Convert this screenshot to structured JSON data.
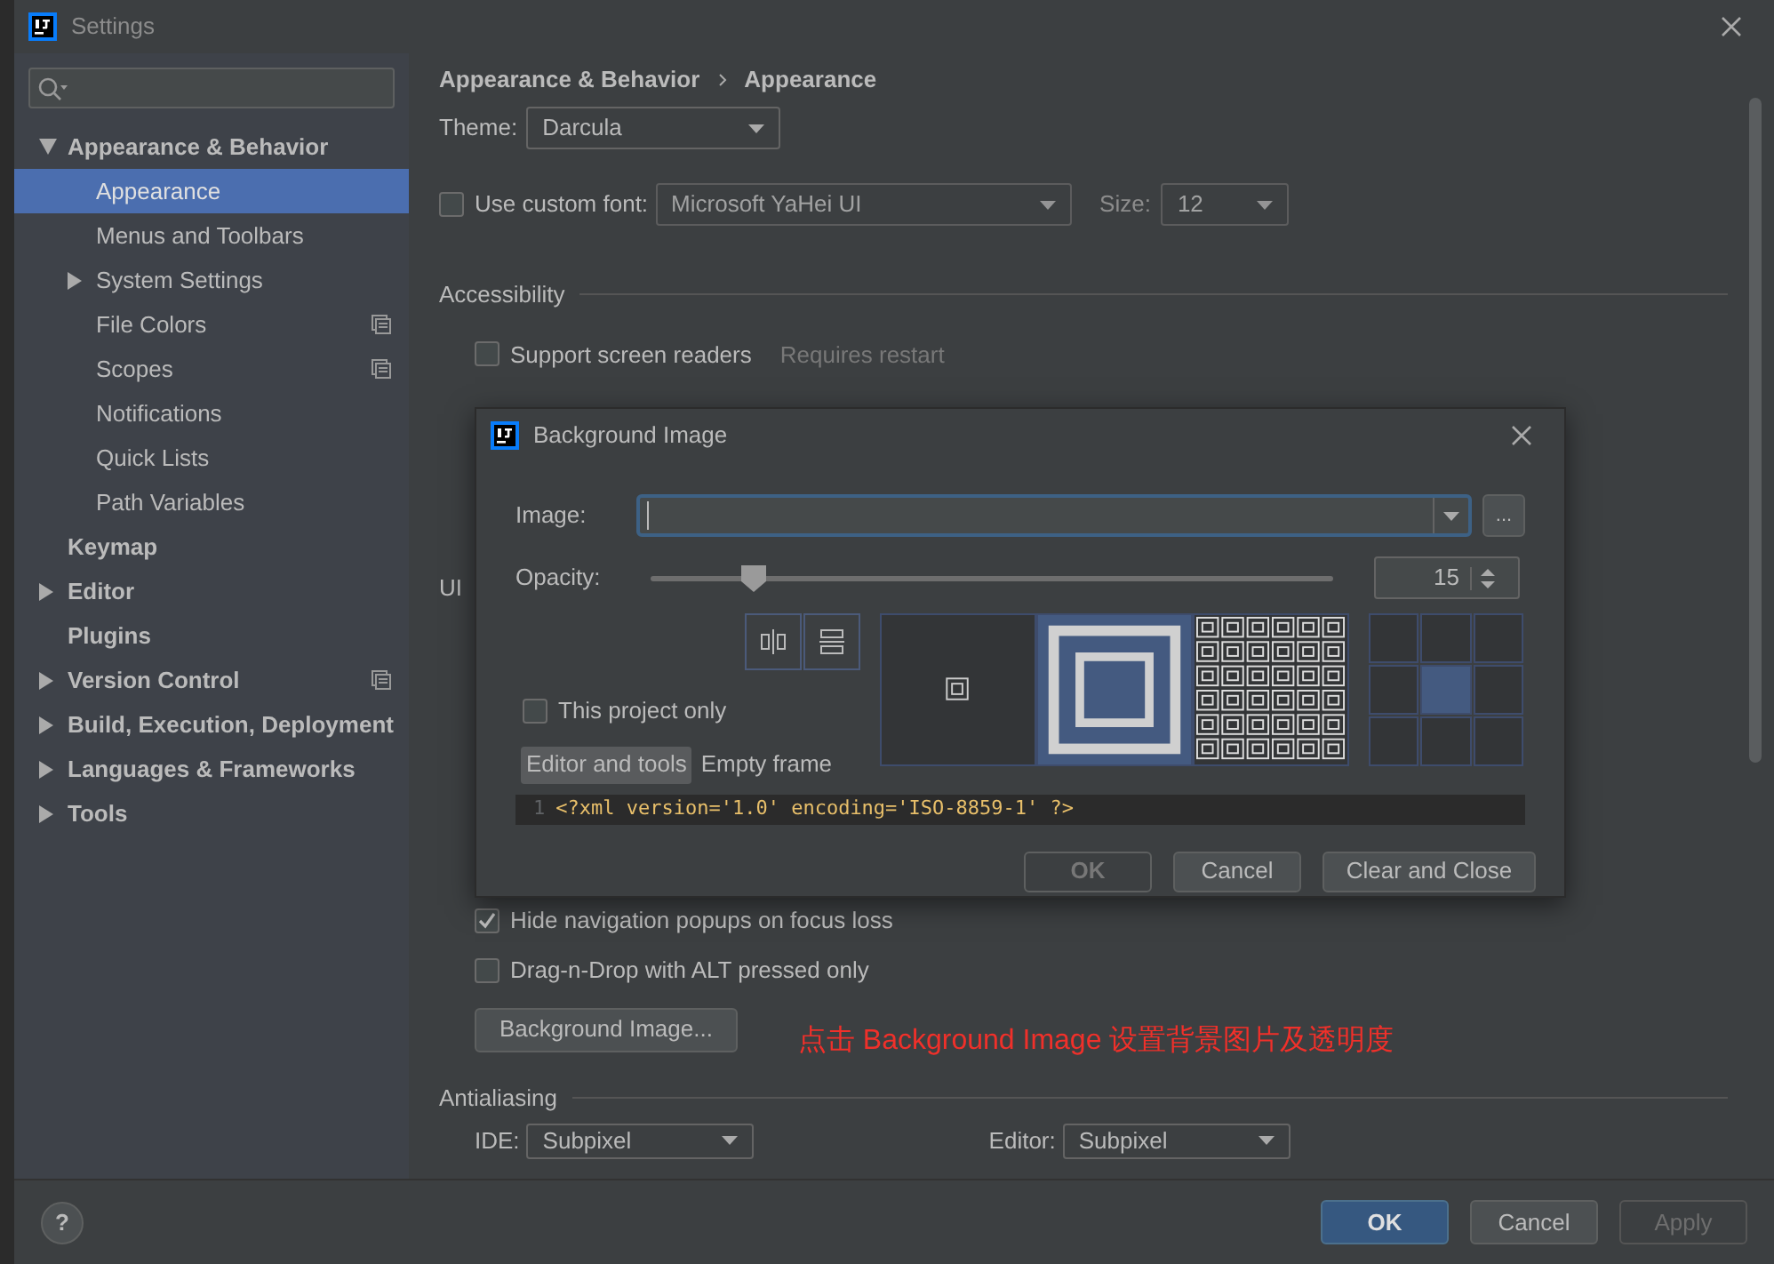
{
  "window": {
    "title": "Settings"
  },
  "sidebar": {
    "items": [
      {
        "label": "Appearance & Behavior",
        "expanded": true,
        "selected": false,
        "per_project": false,
        "children": [
          {
            "label": "Appearance",
            "selected": true,
            "per_project": false
          },
          {
            "label": "Menus and Toolbars",
            "selected": false,
            "per_project": false
          },
          {
            "label": "System Settings",
            "expanded": false,
            "selected": false,
            "per_project": false
          },
          {
            "label": "File Colors",
            "selected": false,
            "per_project": true
          },
          {
            "label": "Scopes",
            "selected": false,
            "per_project": true
          },
          {
            "label": "Notifications",
            "selected": false,
            "per_project": false
          },
          {
            "label": "Quick Lists",
            "selected": false,
            "per_project": false
          },
          {
            "label": "Path Variables",
            "selected": false,
            "per_project": false
          }
        ]
      },
      {
        "label": "Keymap",
        "selected": false,
        "per_project": false
      },
      {
        "label": "Editor",
        "expanded": false,
        "selected": false,
        "per_project": false
      },
      {
        "label": "Plugins",
        "selected": false,
        "per_project": false
      },
      {
        "label": "Version Control",
        "expanded": false,
        "selected": false,
        "per_project": true
      },
      {
        "label": "Build, Execution, Deployment",
        "expanded": false,
        "selected": false,
        "per_project": false
      },
      {
        "label": "Languages & Frameworks",
        "expanded": false,
        "selected": false,
        "per_project": false
      },
      {
        "label": "Tools",
        "expanded": false,
        "selected": false,
        "per_project": false
      }
    ]
  },
  "main": {
    "breadcrumb": [
      "Appearance & Behavior",
      "Appearance"
    ],
    "theme": {
      "label": "Theme:",
      "value": "Darcula"
    },
    "custom_font": {
      "label": "Use custom font:",
      "checked": false,
      "value": "Microsoft YaHei UI",
      "size_label": "Size:",
      "size": "12"
    },
    "accessibility": {
      "title": "Accessibility",
      "option": {
        "label": "Support screen readers",
        "checked": false,
        "note": "Requires restart"
      }
    },
    "ui_options": {
      "title": "UI"
    },
    "options": [
      {
        "label": "Hide navigation popups on focus loss",
        "checked": true
      },
      {
        "label": "Drag-n-Drop with ALT pressed only",
        "checked": false
      }
    ],
    "background_button": "Background Image...",
    "annotation": "点击 Background Image 设置背景图片及透明度",
    "antialiasing": {
      "title": "Antialiasing",
      "ide_label": "IDE:",
      "ide_value": "Subpixel",
      "editor_label": "Editor:",
      "editor_value": "Subpixel"
    }
  },
  "dialog": {
    "title": "Background Image",
    "image_label": "Image:",
    "browse": "...",
    "opacity_label": "Opacity:",
    "opacity": {
      "level": 0.15,
      "reading": "15"
    },
    "this_project_only": {
      "label": "This project only",
      "checked": false
    },
    "tabs": [
      {
        "label": "Editor and tools",
        "selected": true
      },
      {
        "label": "Empty frame",
        "selected": false
      }
    ],
    "fill_modes": [
      {
        "kind": "center",
        "selected": false
      },
      {
        "kind": "scale",
        "selected": true
      },
      {
        "kind": "tile",
        "selected": false
      }
    ],
    "anchors": [
      {
        "selected": false
      },
      {
        "selected": false
      },
      {
        "selected": false
      },
      {
        "selected": false
      },
      {
        "selected": true
      },
      {
        "selected": false
      },
      {
        "selected": false
      },
      {
        "selected": false
      },
      {
        "selected": false
      }
    ],
    "preview": {
      "line_number": "1",
      "code": "<?xml version='1.0' encoding='ISO-8859-1' ?>"
    },
    "buttons": [
      {
        "label": "OK",
        "disabled": true
      },
      {
        "label": "Cancel",
        "disabled": false
      },
      {
        "label": "Clear and Close",
        "disabled": false
      }
    ]
  },
  "footer": {
    "help": "?",
    "buttons": [
      {
        "label": "OK",
        "default": true,
        "disabled": false
      },
      {
        "label": "Cancel",
        "default": false,
        "disabled": false
      },
      {
        "label": "Apply",
        "default": false,
        "disabled": true
      }
    ]
  }
}
